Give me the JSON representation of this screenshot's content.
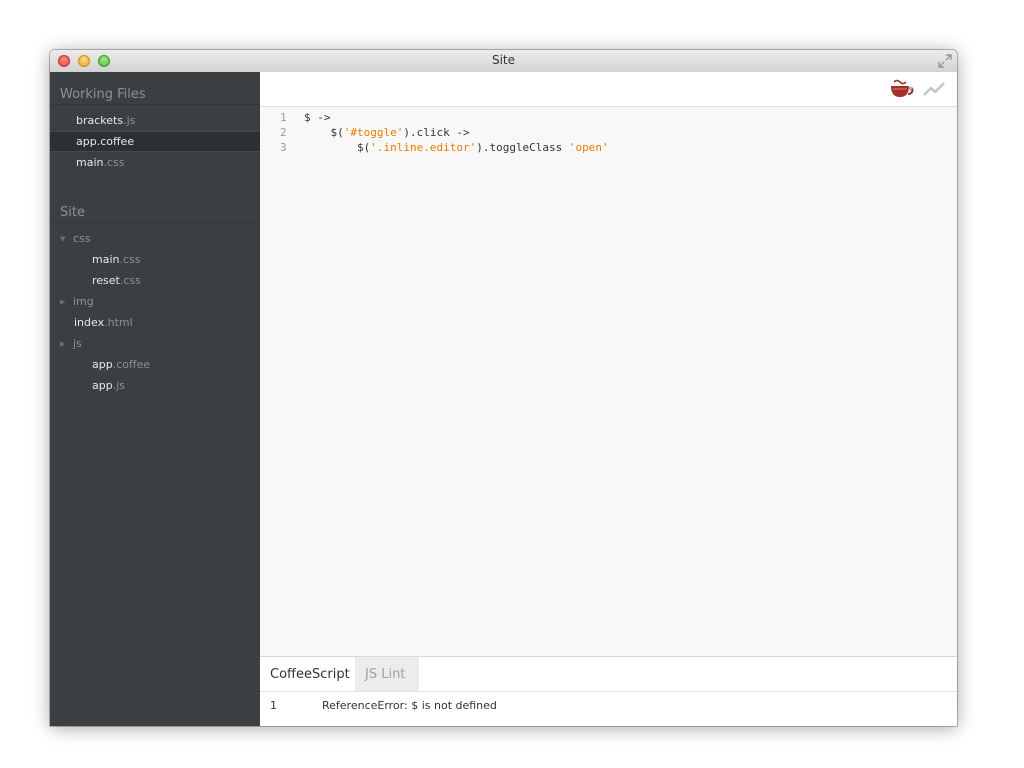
{
  "window": {
    "title": "Site"
  },
  "sidebar": {
    "working_files_title": "Working Files",
    "working_files": [
      {
        "name": "brackets",
        "ext": ".js",
        "selected": false
      },
      {
        "name": "app.coffee",
        "ext": "",
        "selected": true
      },
      {
        "name": "main",
        "ext": ".css",
        "selected": false
      }
    ],
    "project_title": "Site",
    "tree": [
      {
        "name": "css",
        "type": "folder",
        "expanded": true
      },
      {
        "name": "main",
        "ext": ".css",
        "type": "file"
      },
      {
        "name": "reset",
        "ext": ".css",
        "type": "file"
      },
      {
        "name": "img",
        "type": "folder",
        "expanded": false
      },
      {
        "name": "index",
        "ext": ".html",
        "type": "file"
      },
      {
        "name": "js",
        "type": "folder",
        "expanded": true
      },
      {
        "name": "app",
        "ext": ".coffee",
        "type": "file"
      },
      {
        "name": "app",
        "ext": ".js",
        "type": "file"
      }
    ]
  },
  "toolbar": {
    "icons": [
      "coffee-cup-icon",
      "dropdown-arrow-icon",
      "live-preview-icon"
    ]
  },
  "editor": {
    "lines": [
      {
        "number": "1",
        "parts": [
          "$ ->"
        ]
      },
      {
        "number": "2",
        "parts": [
          "    $(",
          "'#toggle'",
          ").click ->"
        ]
      },
      {
        "number": "3",
        "parts": [
          "        $(",
          "'.inline.editor'",
          ").toggleClass ",
          "'open'"
        ]
      }
    ]
  },
  "panel": {
    "tabs": [
      {
        "label": "CoffeeScript",
        "active": true
      },
      {
        "label": "JS Lint",
        "active": false
      }
    ],
    "results": [
      {
        "line": "1",
        "message": "ReferenceError: $ is not defined"
      }
    ]
  },
  "colors": {
    "sidebar_bg": "#3c3f41",
    "string": "#ee7b00",
    "coffee_icon": "#a3302a"
  }
}
